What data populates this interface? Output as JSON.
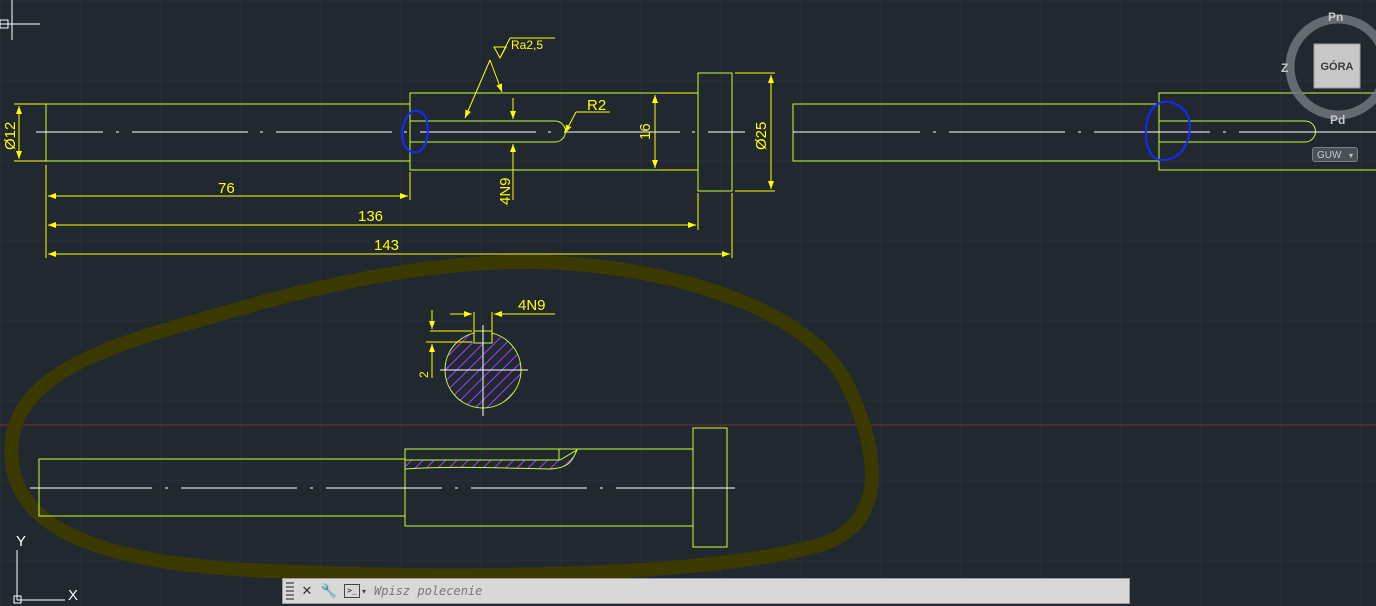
{
  "drawing": {
    "dimensions": {
      "dia_left": "Ø12",
      "dia_right": "Ø25",
      "len_76": "76",
      "len_136": "136",
      "len_143": "143",
      "slot_depth": "16",
      "keyway_width_side": "4N9",
      "radius": "R2",
      "roughness": "Ra2,5",
      "section_keyway_width": "4N9",
      "section_depth": "2"
    }
  },
  "viewcube": {
    "top_face": "GÓRA",
    "north": "Pn",
    "south": "Pd",
    "west": "Z",
    "ucs_label": "GUW"
  },
  "ucs_icon": {
    "x_label": "X",
    "y_label": "Y"
  },
  "command_line": {
    "placeholder": "Wpisz polecenie",
    "close_glyph": "✕",
    "settings_glyph": "🔧",
    "prompt_glyph": ">_",
    "caret_glyph": "▾"
  },
  "colors": {
    "background": "#212830",
    "geometry": "#c8ff32",
    "dimension": "#ffff00",
    "centerline": "#ffffff",
    "highlight_marker": "#3a3a00",
    "blue_marker": "#1428ff",
    "hatch": "#a040ff"
  }
}
